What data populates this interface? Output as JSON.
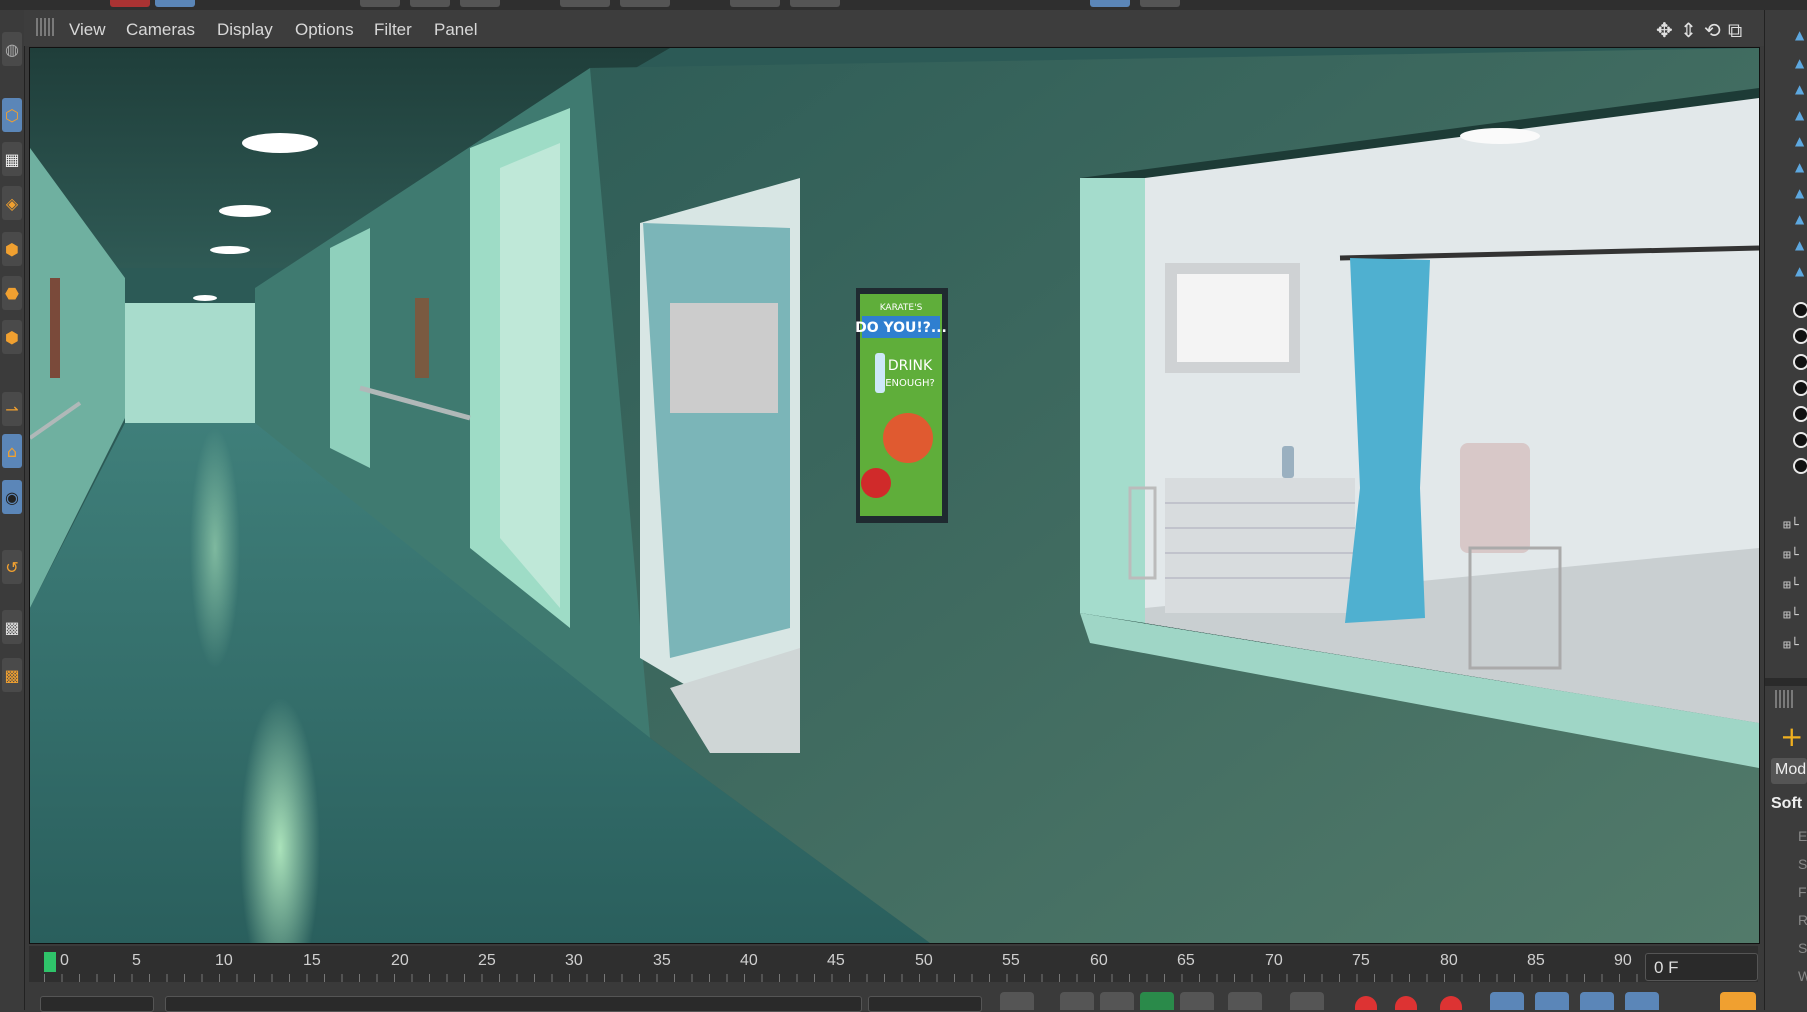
{
  "viewport_menu": {
    "items": [
      "View",
      "Cameras",
      "Display",
      "Options",
      "Filter",
      "Panel"
    ]
  },
  "nav_icons": [
    "move-icon",
    "dolly-icon",
    "rotate-icon",
    "maximize-icon"
  ],
  "timeline": {
    "ticks": [
      "0",
      "5",
      "10",
      "15",
      "20",
      "25",
      "30",
      "35",
      "40",
      "45",
      "50",
      "55",
      "60",
      "65",
      "70",
      "75",
      "80",
      "85",
      "90"
    ],
    "current_frame": "0 F"
  },
  "right_panel": {
    "mode_label": "Mod",
    "soft_label": "Soft",
    "letters": [
      "E",
      "S",
      "F",
      "R",
      "S",
      "W"
    ]
  },
  "scene": {
    "poster": {
      "top_text": "KARATE'S",
      "headline": "DO YOU!?...",
      "line1": "DRINK",
      "line2": "ENOUGH?"
    }
  },
  "colors": {
    "accent_orange": "#f0a030",
    "accent_blue": "#5b86b8",
    "playhead_green": "#2fc46a",
    "record_red": "#d33333"
  }
}
